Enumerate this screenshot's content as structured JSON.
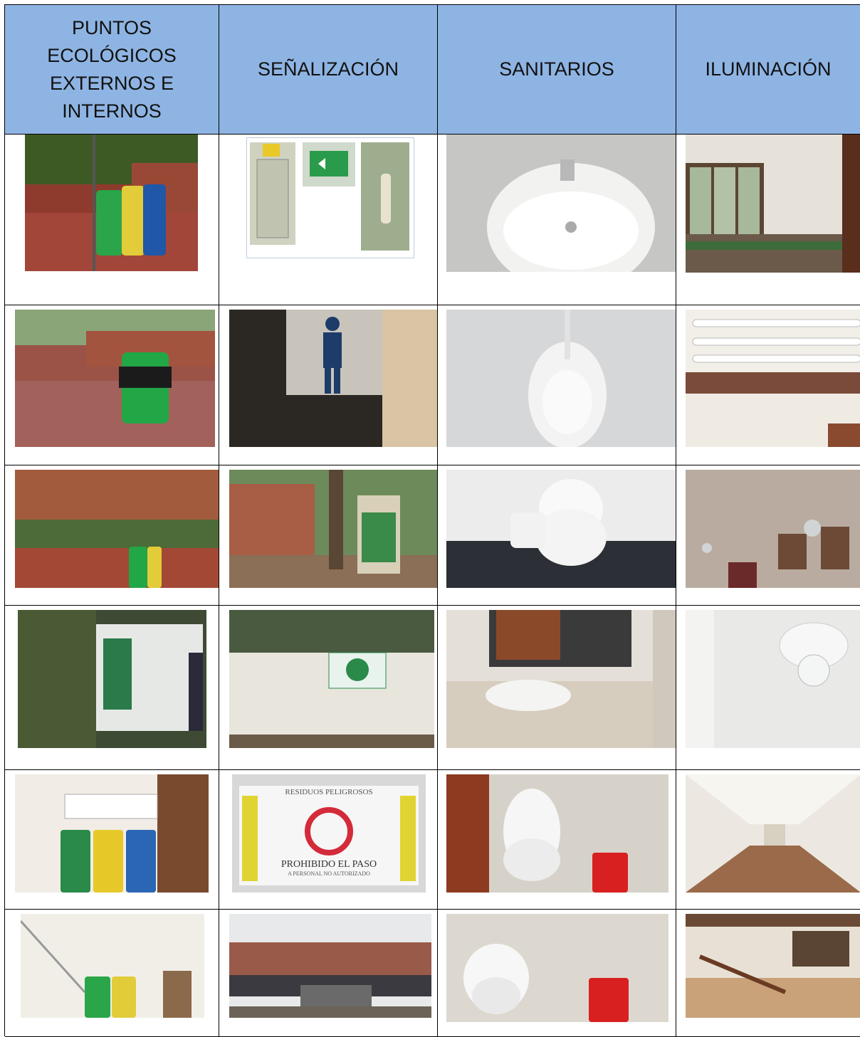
{
  "headers": [
    {
      "label": "PUNTOS\nECOLÓGICOS\nEXTERNOS E\nINTERNOS"
    },
    {
      "label": "SEÑALIZACIÓN"
    },
    {
      "label": "SANITARIOS"
    },
    {
      "label": "ILUMINACIÓN"
    }
  ],
  "rows": [
    [
      "recycling-bins-outdoor-photo",
      "electrical-panel-exit-sign-extinguisher-photo",
      "washbasin-photo",
      "dining-hall-windows-photo"
    ],
    [
      "green-bin-garden-photo",
      "men-restroom-sign-photo",
      "urinal-photo",
      "fluorescent-tube-light-photo"
    ],
    [
      "eco-point-garden-photo",
      "information-board-campus-photo",
      "toilet-photo",
      "hanging-lamps-hall-photo"
    ],
    [
      "storage-shed-photo",
      "recycling-symbol-wall-photo",
      "tiled-sink-mirror-photo",
      "ceiling-bulb-photo"
    ],
    [
      "three-bins-indoor-photo",
      "hazardous-waste-sign-photo",
      "toilet-red-bin-photo",
      "corridor-lights-photo"
    ],
    [
      "two-bins-stairwell-photo",
      "fenced-collection-area-photo",
      "toilet-red-bin-corner-photo",
      "staircase-window-photo"
    ]
  ],
  "signs": {
    "hazard": "RESIDUOS PELIGROSOS",
    "prohibido": "PROHIBIDO EL PASO",
    "personal": "A PERSONAL NO AUTORIZADO"
  }
}
